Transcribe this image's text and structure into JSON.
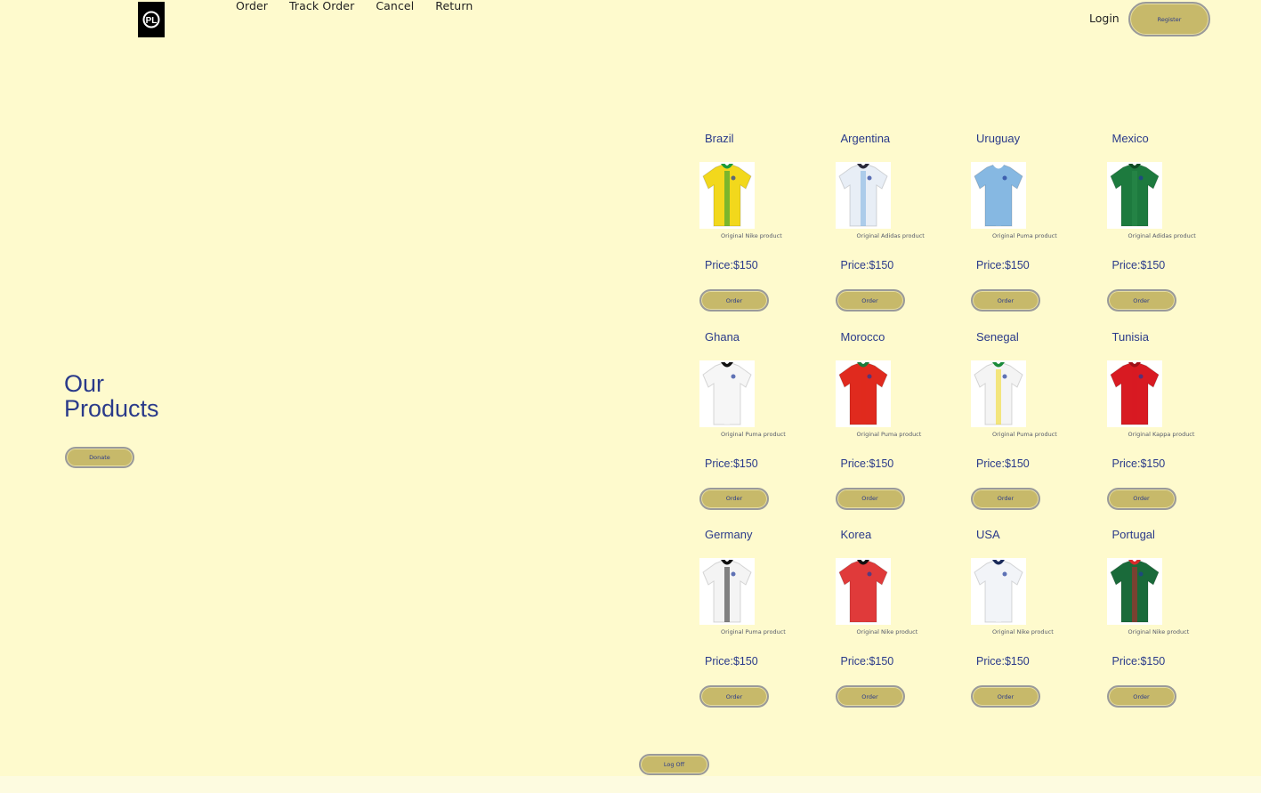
{
  "header": {
    "logo_text": "PL",
    "nav": [
      "Order",
      "Track Order",
      "Cancel",
      "Return"
    ],
    "login_label": "Login",
    "register_label": "Register"
  },
  "hero": {
    "title_line1": "Our",
    "title_line2": "Products",
    "donate_label": "Donate"
  },
  "products": [
    {
      "name": "Brazil",
      "brand": "Original Nike product",
      "price": "Price:$150",
      "order_label": "Order",
      "shirt": {
        "body": "#f2d81c",
        "collar": "#1a9a3a",
        "stripe": "#1a9a3a"
      }
    },
    {
      "name": "Argentina",
      "brand": "Original Adidas product",
      "price": "Price:$150",
      "order_label": "Order",
      "shirt": {
        "body": "#e8eef6",
        "collar": "#2a2a3a",
        "stripe": "#7ab0e0"
      }
    },
    {
      "name": "Uruguay",
      "brand": "Original Puma product",
      "price": "Price:$150",
      "order_label": "Order",
      "shirt": {
        "body": "#86b8e2",
        "collar": "#ffffff",
        "stripe": "#86b8e2"
      }
    },
    {
      "name": "Mexico",
      "brand": "Original Adidas product",
      "price": "Price:$150",
      "order_label": "Order",
      "shirt": {
        "body": "#1d7a3e",
        "collar": "#0f4a24",
        "stripe": "#2a8a4a"
      }
    },
    {
      "name": "Ghana",
      "brand": "Original Puma product",
      "price": "Price:$150",
      "order_label": "Order",
      "shirt": {
        "body": "#f6f6f6",
        "collar": "#111111",
        "stripe": "#f6f6f6"
      }
    },
    {
      "name": "Morocco",
      "brand": "Original Puma product",
      "price": "Price:$150",
      "order_label": "Order",
      "shirt": {
        "body": "#e02a1e",
        "collar": "#1a7a3a",
        "stripe": "#e02a1e"
      }
    },
    {
      "name": "Senegal",
      "brand": "Original Puma product",
      "price": "Price:$150",
      "order_label": "Order",
      "shirt": {
        "body": "#f4f4f4",
        "collar": "#1a8a3a",
        "stripe": "#f2d81c"
      }
    },
    {
      "name": "Tunisia",
      "brand": "Original Kappa product",
      "price": "Price:$150",
      "order_label": "Order",
      "shirt": {
        "body": "#d81a22",
        "collar": "#a01018",
        "stripe": "#d81a22"
      }
    },
    {
      "name": "Germany",
      "brand": "Original Puma product",
      "price": "Price:$150",
      "order_label": "Order",
      "shirt": {
        "body": "#f4f4f4",
        "collar": "#111111",
        "stripe": "#222222"
      }
    },
    {
      "name": "Korea",
      "brand": "Original Nike product",
      "price": "Price:$150",
      "order_label": "Order",
      "shirt": {
        "body": "#e03a3a",
        "collar": "#111111",
        "stripe": "#e03a3a"
      }
    },
    {
      "name": "USA",
      "brand": "Original Nike product",
      "price": "Price:$150",
      "order_label": "Order",
      "shirt": {
        "body": "#f2f4f8",
        "collar": "#1a2a5a",
        "stripe": "#f2f4f8"
      }
    },
    {
      "name": "Portugal",
      "brand": "Original Nike product",
      "price": "Price:$150",
      "order_label": "Order",
      "shirt": {
        "body": "#1a6a3a",
        "collar": "#d82a2a",
        "stripe": "#c8202a"
      }
    }
  ],
  "footer": {
    "logoff_label": "Log Off"
  },
  "colors": {
    "background": "#fefacd",
    "accent_text": "#2a3a8a",
    "button": "#c7b96a"
  }
}
